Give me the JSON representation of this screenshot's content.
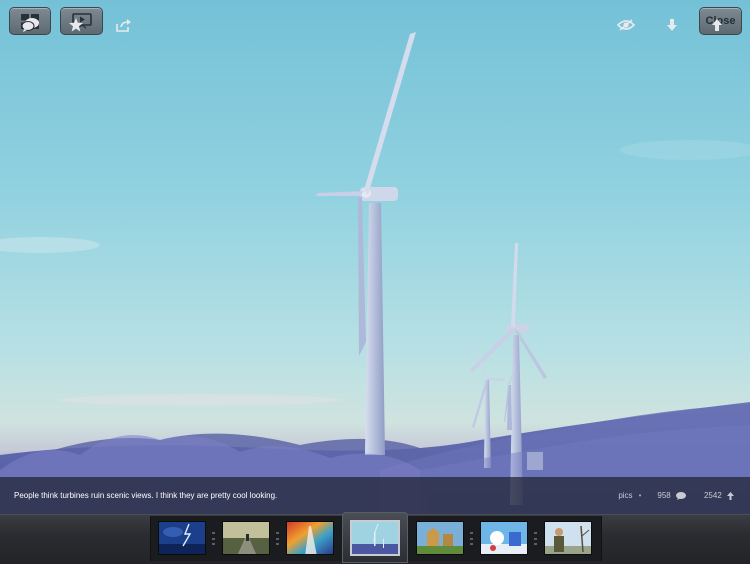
{
  "top_bar": {
    "grid_icon": "grid-icon",
    "slideshow_icon": "slideshow-icon",
    "close_label": "Close"
  },
  "photo": {
    "subject": "wind-turbines-photo"
  },
  "caption": {
    "text": "People think turbines ruin scenic views. I think they are pretty cool looking.",
    "source": "pics",
    "comments": "958",
    "score": "2542"
  },
  "toolbar": {
    "left_icons": [
      "comments-icon",
      "star-icon",
      "share-icon"
    ],
    "right_icons": [
      "eye-icon",
      "downvote-arrow-icon",
      "upvote-arrow-icon"
    ]
  },
  "thumbnails": [
    {
      "name": "thumb-storm"
    },
    {
      "name": "thumb-road"
    },
    {
      "name": "thumb-rainbow"
    },
    {
      "name": "thumb-turbines",
      "current": true
    },
    {
      "name": "thumb-castle"
    },
    {
      "name": "thumb-cartoon"
    },
    {
      "name": "thumb-person"
    }
  ],
  "colors": {
    "toolbar": "#2a2c30",
    "caption_bg": "#1e2230",
    "accent_current": "#c9ccd2"
  }
}
